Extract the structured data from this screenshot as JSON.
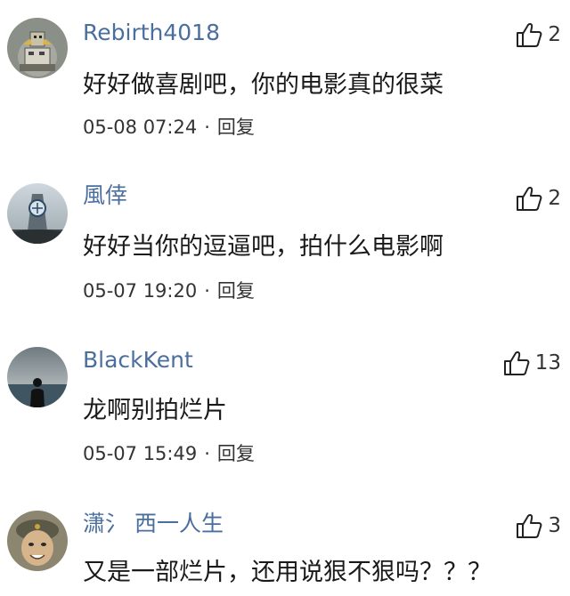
{
  "comments": [
    {
      "username": "Rebirth4018",
      "likes": "2",
      "content": "好好做喜剧吧，你的电影真的很菜",
      "time": "05-08 07:24",
      "reply_label": "回复",
      "avatar_icon": "avatar-robot-icon",
      "like_icon": "thumbs-up-icon"
    },
    {
      "username": "風倖",
      "likes": "2",
      "content": "好好当你的逗逼吧，拍什么电影啊",
      "time": "05-07 19:20",
      "reply_label": "回复",
      "avatar_icon": "avatar-building-icon",
      "like_icon": "thumbs-up-icon"
    },
    {
      "username": "BlackKent",
      "likes": "13",
      "content": "龙啊别拍烂片",
      "time": "05-07 15:49",
      "reply_label": "回复",
      "avatar_icon": "avatar-sea-person-icon",
      "like_icon": "thumbs-up-icon"
    },
    {
      "username": "潇氵 西一人生",
      "likes": "3",
      "content": "又是一部烂片，还用说狠不狠吗？？？",
      "time": "",
      "reply_label": "",
      "avatar_icon": "avatar-soldier-icon",
      "like_icon": "thumbs-up-icon"
    }
  ],
  "separator": "·",
  "colors": {
    "username": "#4a6f9e",
    "content": "#1a1a1a",
    "meta": "#333333"
  }
}
